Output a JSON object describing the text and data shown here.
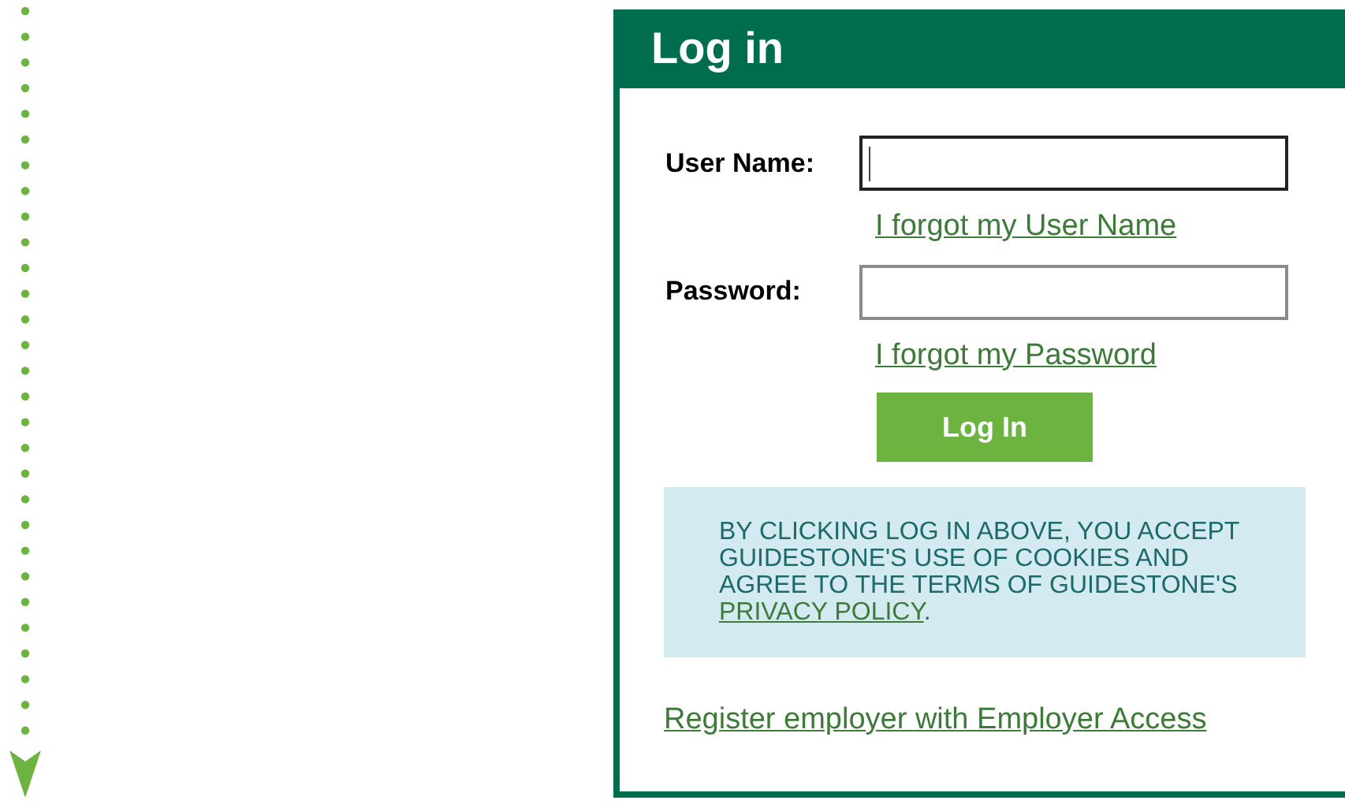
{
  "panel": {
    "title": "Log in"
  },
  "fields": [
    {
      "label": "User Name:",
      "focused": true,
      "link": "I forgot my User Name"
    },
    {
      "label": "Password:",
      "focused": false,
      "link": "I forgot my Password"
    }
  ],
  "submit": "Log In",
  "notice": {
    "text": "BY CLICKING LOG IN ABOVE, YOU ACCEPT GUIDESTONE'S USE OF COOKIES AND AGREE TO THE TERMS OF GUIDESTONE'S",
    "link": "PRIVACY POLICY",
    "end": "."
  },
  "register_link": "Register employer with Employer Access"
}
